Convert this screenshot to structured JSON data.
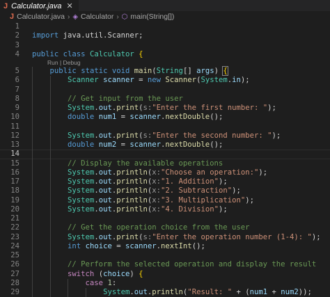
{
  "tab": {
    "icon_letter": "J",
    "title": "Calculator.java",
    "close_glyph": "✕"
  },
  "breadcrumb": {
    "file": "Calculator.java",
    "class": "Calculator",
    "method": "main(String[])"
  },
  "codelens": "Run | Debug",
  "active_line": 14,
  "lines": [
    {
      "n": "1",
      "t": []
    },
    {
      "n": "2",
      "t": [
        [
          "kw",
          "import"
        ],
        [
          "pl",
          " java.util.Scanner;"
        ]
      ]
    },
    {
      "n": "3",
      "t": []
    },
    {
      "n": "4",
      "t": [
        [
          "kw",
          "public"
        ],
        [
          "pl",
          " "
        ],
        [
          "kw",
          "class"
        ],
        [
          "pl",
          " "
        ],
        [
          "ty",
          "Calculator"
        ],
        [
          "pl",
          " "
        ],
        [
          "br",
          "{"
        ]
      ]
    },
    {
      "n": "5",
      "lens": true,
      "t": [
        [
          "pl",
          "    "
        ],
        [
          "kw",
          "public"
        ],
        [
          "pl",
          " "
        ],
        [
          "kw",
          "static"
        ],
        [
          "pl",
          " "
        ],
        [
          "kw",
          "void"
        ],
        [
          "pl",
          " "
        ],
        [
          "fn",
          "main"
        ],
        [
          "pl",
          "("
        ],
        [
          "ty",
          "String"
        ],
        [
          "pl",
          "[] "
        ],
        [
          "vr",
          "args"
        ],
        [
          "pl",
          ") "
        ],
        [
          "brh",
          "{"
        ]
      ]
    },
    {
      "n": "6",
      "t": [
        [
          "pl",
          "        "
        ],
        [
          "ty",
          "Scanner"
        ],
        [
          "pl",
          " "
        ],
        [
          "vr",
          "scanner"
        ],
        [
          "pl",
          " = "
        ],
        [
          "kw",
          "new"
        ],
        [
          "pl",
          " "
        ],
        [
          "fn",
          "Scanner"
        ],
        [
          "pl",
          "("
        ],
        [
          "ty",
          "System"
        ],
        [
          "pl",
          "."
        ],
        [
          "vr",
          "in"
        ],
        [
          "pl",
          ");"
        ]
      ]
    },
    {
      "n": "7",
      "t": []
    },
    {
      "n": "8",
      "t": [
        [
          "pl",
          "        "
        ],
        [
          "cm",
          "// Get input from the user"
        ]
      ]
    },
    {
      "n": "9",
      "t": [
        [
          "pl",
          "        "
        ],
        [
          "ty",
          "System"
        ],
        [
          "pl",
          "."
        ],
        [
          "vr",
          "out"
        ],
        [
          "pl",
          "."
        ],
        [
          "fn",
          "print"
        ],
        [
          "pl",
          "("
        ],
        [
          "hint",
          "s:"
        ],
        [
          "str",
          "\"Enter the first number: \""
        ],
        [
          "pl",
          ");"
        ]
      ]
    },
    {
      "n": "10",
      "t": [
        [
          "pl",
          "        "
        ],
        [
          "kw",
          "double"
        ],
        [
          "pl",
          " "
        ],
        [
          "vr",
          "num1"
        ],
        [
          "pl",
          " = "
        ],
        [
          "vr",
          "scanner"
        ],
        [
          "pl",
          "."
        ],
        [
          "fn",
          "nextDouble"
        ],
        [
          "pl",
          "();"
        ]
      ]
    },
    {
      "n": "11",
      "t": []
    },
    {
      "n": "12",
      "t": [
        [
          "pl",
          "        "
        ],
        [
          "ty",
          "System"
        ],
        [
          "pl",
          "."
        ],
        [
          "vr",
          "out"
        ],
        [
          "pl",
          "."
        ],
        [
          "fn",
          "print"
        ],
        [
          "pl",
          "("
        ],
        [
          "hint",
          "s:"
        ],
        [
          "str",
          "\"Enter the second number: \""
        ],
        [
          "pl",
          ");"
        ]
      ]
    },
    {
      "n": "13",
      "t": [
        [
          "pl",
          "        "
        ],
        [
          "kw",
          "double"
        ],
        [
          "pl",
          " "
        ],
        [
          "vr",
          "num2"
        ],
        [
          "pl",
          " = "
        ],
        [
          "vr",
          "scanner"
        ],
        [
          "pl",
          "."
        ],
        [
          "fn",
          "nextDouble"
        ],
        [
          "pl",
          "();"
        ]
      ]
    },
    {
      "n": "14",
      "t": []
    },
    {
      "n": "15",
      "t": [
        [
          "pl",
          "        "
        ],
        [
          "cm",
          "// Display the available operations"
        ]
      ]
    },
    {
      "n": "16",
      "t": [
        [
          "pl",
          "        "
        ],
        [
          "ty",
          "System"
        ],
        [
          "pl",
          "."
        ],
        [
          "vr",
          "out"
        ],
        [
          "pl",
          "."
        ],
        [
          "fn",
          "println"
        ],
        [
          "pl",
          "("
        ],
        [
          "hint",
          "x:"
        ],
        [
          "str",
          "\"Choose an operation:\""
        ],
        [
          "pl",
          ");"
        ]
      ]
    },
    {
      "n": "17",
      "t": [
        [
          "pl",
          "        "
        ],
        [
          "ty",
          "System"
        ],
        [
          "pl",
          "."
        ],
        [
          "vr",
          "out"
        ],
        [
          "pl",
          "."
        ],
        [
          "fn",
          "println"
        ],
        [
          "pl",
          "("
        ],
        [
          "hint",
          "x:"
        ],
        [
          "str",
          "\"1. Addition\""
        ],
        [
          "pl",
          ");"
        ]
      ]
    },
    {
      "n": "18",
      "t": [
        [
          "pl",
          "        "
        ],
        [
          "ty",
          "System"
        ],
        [
          "pl",
          "."
        ],
        [
          "vr",
          "out"
        ],
        [
          "pl",
          "."
        ],
        [
          "fn",
          "println"
        ],
        [
          "pl",
          "("
        ],
        [
          "hint",
          "x:"
        ],
        [
          "str",
          "\"2. Subtraction\""
        ],
        [
          "pl",
          ");"
        ]
      ]
    },
    {
      "n": "19",
      "t": [
        [
          "pl",
          "        "
        ],
        [
          "ty",
          "System"
        ],
        [
          "pl",
          "."
        ],
        [
          "vr",
          "out"
        ],
        [
          "pl",
          "."
        ],
        [
          "fn",
          "println"
        ],
        [
          "pl",
          "("
        ],
        [
          "hint",
          "x:"
        ],
        [
          "str",
          "\"3. Multiplication\""
        ],
        [
          "pl",
          ");"
        ]
      ]
    },
    {
      "n": "20",
      "t": [
        [
          "pl",
          "        "
        ],
        [
          "ty",
          "System"
        ],
        [
          "pl",
          "."
        ],
        [
          "vr",
          "out"
        ],
        [
          "pl",
          "."
        ],
        [
          "fn",
          "println"
        ],
        [
          "pl",
          "("
        ],
        [
          "hint",
          "x:"
        ],
        [
          "str",
          "\"4. Division\""
        ],
        [
          "pl",
          ");"
        ]
      ]
    },
    {
      "n": "21",
      "t": []
    },
    {
      "n": "22",
      "t": [
        [
          "pl",
          "        "
        ],
        [
          "cm",
          "// Get the operation choice from the user"
        ]
      ]
    },
    {
      "n": "23",
      "t": [
        [
          "pl",
          "        "
        ],
        [
          "ty",
          "System"
        ],
        [
          "pl",
          "."
        ],
        [
          "vr",
          "out"
        ],
        [
          "pl",
          "."
        ],
        [
          "fn",
          "print"
        ],
        [
          "pl",
          "("
        ],
        [
          "hint",
          "s:"
        ],
        [
          "str",
          "\"Enter the operation number (1-4): \""
        ],
        [
          "pl",
          ");"
        ]
      ]
    },
    {
      "n": "24",
      "t": [
        [
          "pl",
          "        "
        ],
        [
          "kw",
          "int"
        ],
        [
          "pl",
          " "
        ],
        [
          "vr",
          "choice"
        ],
        [
          "pl",
          " = "
        ],
        [
          "vr",
          "scanner"
        ],
        [
          "pl",
          "."
        ],
        [
          "fn",
          "nextInt"
        ],
        [
          "pl",
          "();"
        ]
      ]
    },
    {
      "n": "25",
      "t": []
    },
    {
      "n": "26",
      "t": [
        [
          "pl",
          "        "
        ],
        [
          "cm",
          "// Perform the selected operation and display the result"
        ]
      ]
    },
    {
      "n": "27",
      "t": [
        [
          "pl",
          "        "
        ],
        [
          "ctl",
          "switch"
        ],
        [
          "pl",
          " ("
        ],
        [
          "vr",
          "choice"
        ],
        [
          "pl",
          ") "
        ],
        [
          "br",
          "{"
        ]
      ]
    },
    {
      "n": "28",
      "t": [
        [
          "pl",
          "            "
        ],
        [
          "ctl",
          "case"
        ],
        [
          "pl",
          " "
        ],
        [
          "num",
          "1"
        ],
        [
          "pl",
          ":"
        ]
      ]
    },
    {
      "n": "29",
      "t": [
        [
          "pl",
          "                "
        ],
        [
          "ty",
          "System"
        ],
        [
          "pl",
          "."
        ],
        [
          "vr",
          "out"
        ],
        [
          "pl",
          "."
        ],
        [
          "fn",
          "println"
        ],
        [
          "pl",
          "("
        ],
        [
          "str",
          "\"Result: \""
        ],
        [
          "pl",
          " + ("
        ],
        [
          "vr",
          "num1"
        ],
        [
          "pl",
          " + "
        ],
        [
          "vr",
          "num2"
        ],
        [
          "pl",
          "));"
        ]
      ]
    }
  ]
}
